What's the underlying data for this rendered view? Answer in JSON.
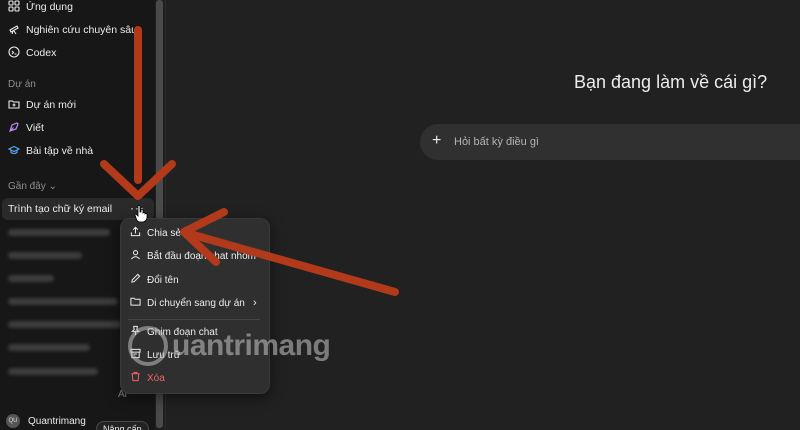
{
  "sidebar": {
    "nav": [
      {
        "label": "Ứng dụng",
        "icon": "apps-grid-icon"
      },
      {
        "label": "Nghiên cứu chuyên sâu",
        "icon": "telescope-icon"
      },
      {
        "label": "Codex",
        "icon": "codex-icon"
      }
    ],
    "projects_label": "Dự án",
    "projects": [
      {
        "label": "Dự án mới",
        "icon": "new-folder-icon"
      },
      {
        "label": "Viết",
        "icon": "pen-nib-icon"
      },
      {
        "label": "Bài tập về nhà",
        "icon": "graduation-cap-icon"
      }
    ],
    "recent_label": "Gần đây",
    "recent_active": "Trình tạo chữ ký email",
    "recent_dots": "···",
    "ai_label": "Ai",
    "user": {
      "name": "Quantrimang",
      "avatar": "QU",
      "upgrade": "Nâng cấp"
    }
  },
  "main": {
    "heading": "Bạn đang làm về cái gì?",
    "prompt_plus": "+",
    "prompt_placeholder": "Hỏi bất kỳ điều gì"
  },
  "context_menu": {
    "items": [
      {
        "label": "Chia sẻ",
        "icon": "share-icon"
      },
      {
        "label": "Bắt đầu đoạn chat nhóm",
        "icon": "person-icon"
      },
      {
        "label": "Đổi tên",
        "icon": "pencil-icon"
      },
      {
        "label": "Di chuyển sang dự án",
        "icon": "folder-icon",
        "chevron": "›"
      },
      {
        "label": "Ghim đoạn chat",
        "icon": "pin-icon"
      },
      {
        "label": "Lưu trữ",
        "icon": "archive-icon"
      },
      {
        "label": "Xóa",
        "icon": "trash-icon",
        "danger": true
      }
    ]
  },
  "watermark": {
    "text": "uantrimang"
  },
  "colors": {
    "accent_arrow": "#b23a1a",
    "danger": "#f06262",
    "background": "#212121",
    "sidebar": "#171717"
  }
}
